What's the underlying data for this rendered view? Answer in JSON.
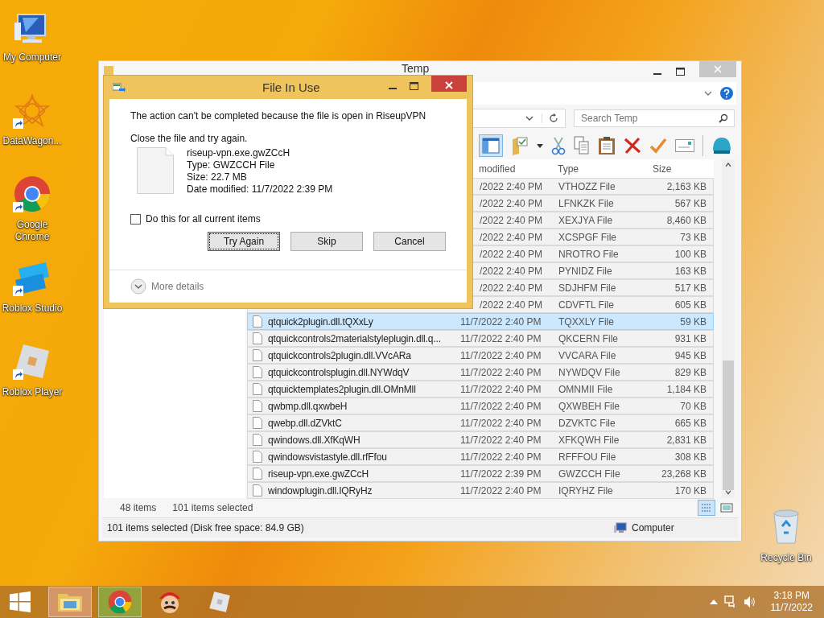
{
  "desktop_icons": [
    {
      "label": "My Computer",
      "kind": "computer",
      "shortcut": false
    },
    {
      "label": "DataWagon...",
      "kind": "datawagon",
      "shortcut": true
    },
    {
      "label": "Google Chrome",
      "kind": "chrome",
      "shortcut": true
    },
    {
      "label": "Roblox Studio",
      "kind": "studio",
      "shortcut": true
    },
    {
      "label": "Roblox Player",
      "kind": "player",
      "shortcut": true
    }
  ],
  "recycle_bin": {
    "label": "Recycle Bin"
  },
  "explorer": {
    "title": "Temp",
    "search": {
      "placeholder": "Search Temp"
    },
    "columns": [
      {
        "label": "modified",
        "kind": "date"
      },
      {
        "label": "Type",
        "kind": "type"
      },
      {
        "label": "Size",
        "kind": "size"
      }
    ],
    "rows": [
      {
        "modified": "/2022 2:40 PM",
        "type": "VTHOZZ File",
        "size": "2,163 KB",
        "selected": true,
        "focused": false
      },
      {
        "modified": "/2022 2:40 PM",
        "type": "LFNKZK File",
        "size": "567 KB",
        "selected": true,
        "focused": false
      },
      {
        "modified": "/2022 2:40 PM",
        "type": "XEXJYA File",
        "size": "8,460 KB",
        "selected": true,
        "focused": false
      },
      {
        "modified": "/2022 2:40 PM",
        "type": "XCSPGF File",
        "size": "73 KB",
        "selected": true,
        "focused": false
      },
      {
        "modified": "/2022 2:40 PM",
        "type": "NROTRO File",
        "size": "100 KB",
        "selected": true,
        "focused": false
      },
      {
        "modified": "/2022 2:40 PM",
        "type": "PYNIDZ File",
        "size": "163 KB",
        "selected": true,
        "focused": false
      },
      {
        "modified": "/2022 2:40 PM",
        "type": "SDJHFM File",
        "size": "517 KB",
        "selected": true,
        "focused": false
      },
      {
        "modified": "/2022 2:40 PM",
        "type": "CDVFTL File",
        "size": "605 KB",
        "selected": true,
        "focused": false
      },
      {
        "name": "qtquick2plugin.dll.tQXxLy",
        "modified": "11/7/2022 2:40 PM",
        "type": "TQXXLY File",
        "size": "59 KB",
        "selected": true,
        "focused": true
      },
      {
        "name": "qtquickcontrols2materialstyleplugin.dll.q...",
        "modified": "11/7/2022 2:40 PM",
        "type": "QKCERN File",
        "size": "931 KB",
        "selected": true,
        "focused": false
      },
      {
        "name": "qtquickcontrols2plugin.dll.VVcARa",
        "modified": "11/7/2022 2:40 PM",
        "type": "VVCARA File",
        "size": "945 KB",
        "selected": true,
        "focused": false
      },
      {
        "name": "qtquickcontrolsplugin.dll.NYWdqV",
        "modified": "11/7/2022 2:40 PM",
        "type": "NYWDQV File",
        "size": "829 KB",
        "selected": true,
        "focused": false
      },
      {
        "name": "qtquicktemplates2plugin.dll.OMnMll",
        "modified": "11/7/2022 2:40 PM",
        "type": "OMNMII File",
        "size": "1,184 KB",
        "selected": true,
        "focused": false
      },
      {
        "name": "qwbmp.dll.qxwbeH",
        "modified": "11/7/2022 2:40 PM",
        "type": "QXWBEH File",
        "size": "70 KB",
        "selected": true,
        "focused": false
      },
      {
        "name": "qwebp.dll.dZVktC",
        "modified": "11/7/2022 2:40 PM",
        "type": "DZVKTC File",
        "size": "665 KB",
        "selected": true,
        "focused": false
      },
      {
        "name": "qwindows.dll.XfKqWH",
        "modified": "11/7/2022 2:40 PM",
        "type": "XFKQWH File",
        "size": "2,831 KB",
        "selected": true,
        "focused": false
      },
      {
        "name": "qwindowsvistastyle.dll.rfFfou",
        "modified": "11/7/2022 2:40 PM",
        "type": "RFFFOU File",
        "size": "308 KB",
        "selected": true,
        "focused": false
      },
      {
        "name": "riseup-vpn.exe.gwZCcH",
        "modified": "11/7/2022 2:39 PM",
        "type": "GWZCCH File",
        "size": "23,268 KB",
        "selected": true,
        "focused": false
      },
      {
        "name": "windowplugin.dll.IQRyHz",
        "modified": "11/7/2022 2:40 PM",
        "type": "IQRYHZ File",
        "size": "170 KB",
        "selected": true,
        "focused": false
      }
    ],
    "item_count": "48 items",
    "selected_count": "101 items selected",
    "status": "101 items selected (Disk free space: 84.9 GB)",
    "location": "Computer"
  },
  "dialog": {
    "title": "File In Use",
    "message": "The action can't be completed because the file is open in RiseupVPN",
    "instruction": "Close the file and try again.",
    "file": {
      "name": "riseup-vpn.exe.gwZCcH",
      "type": "Type: GWZCCH File",
      "size": "Size: 22.7 MB",
      "date": "Date modified: 11/7/2022 2:39 PM"
    },
    "checkbox": {
      "label": "Do this for all current items",
      "checked": false
    },
    "buttons": [
      {
        "label": "Try Again",
        "focused": true
      },
      {
        "label": "Skip",
        "focused": false
      },
      {
        "label": "Cancel",
        "focused": false
      }
    ],
    "more_details": "More details"
  },
  "taskbar": {
    "apps": [
      {
        "kind": "explorer",
        "running": true
      },
      {
        "kind": "chrome",
        "running": true
      },
      {
        "kind": "game",
        "running": false
      },
      {
        "kind": "player",
        "running": false
      }
    ],
    "time": "3:18 PM",
    "date": "11/7/2022"
  }
}
